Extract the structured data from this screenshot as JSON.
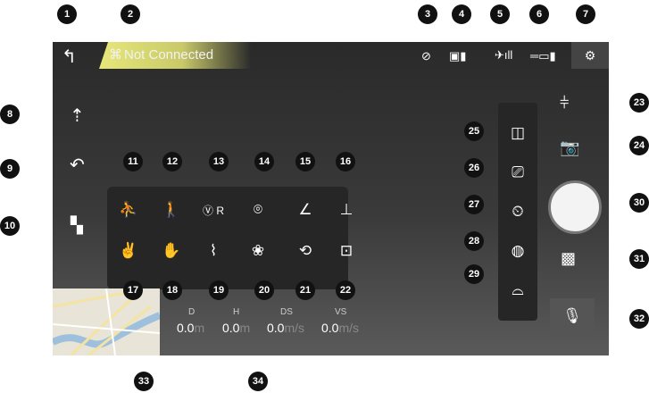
{
  "status": {
    "connection_text": "Not Connected",
    "connection_symbol": "⌘"
  },
  "telemetry": [
    {
      "label": "D",
      "value": "0.0",
      "unit": "m"
    },
    {
      "label": "H",
      "value": "0.0",
      "unit": "m"
    },
    {
      "label": "DS",
      "value": "0.0",
      "unit": "m/s"
    },
    {
      "label": "VS",
      "value": "0.0",
      "unit": "m/s"
    }
  ],
  "callouts": [
    "1",
    "2",
    "3",
    "4",
    "5",
    "6",
    "7",
    "8",
    "9",
    "10",
    "11",
    "12",
    "13",
    "14",
    "15",
    "16",
    "17",
    "18",
    "19",
    "20",
    "21",
    "22",
    "23",
    "24",
    "25",
    "26",
    "27",
    "28",
    "29",
    "30",
    "31",
    "32",
    "33",
    "34"
  ],
  "colors": {
    "connection_bar": "#e7e77a",
    "screen_bg": "#2f2f2f"
  }
}
